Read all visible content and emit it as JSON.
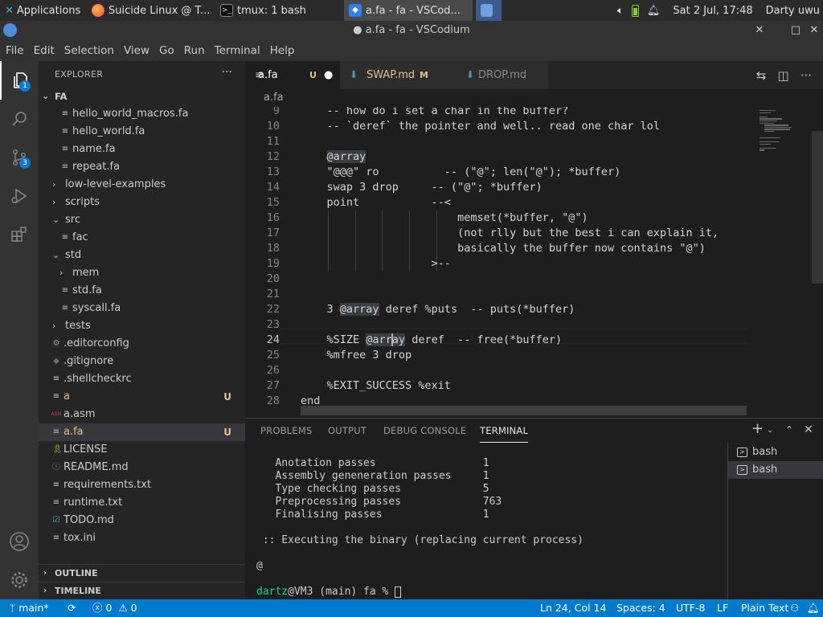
{
  "os_panel": {
    "apps_label": "Applications",
    "tasks": [
      {
        "label": "Suicide Linux @ T...",
        "icon": "firefox-icon"
      },
      {
        "label": "tmux: 1 bash",
        "icon": "terminal-icon"
      },
      {
        "label": "a.fa - fa - VSCod...",
        "icon": "vscodium-icon"
      }
    ],
    "clock": "Sat  2 Jul, 17:48",
    "user": "Darty uwu"
  },
  "window": {
    "title": "● a.fa - fa - VSCodium"
  },
  "menu": [
    "File",
    "Edit",
    "Selection",
    "View",
    "Go",
    "Run",
    "Terminal",
    "Help"
  ],
  "activity": {
    "explorer_badge": "1",
    "scm_badge": "3"
  },
  "sidebar": {
    "header": "EXPLORER",
    "more": "···",
    "root": "FA",
    "items": [
      {
        "label": "hello_world_macros.fa",
        "type": "file",
        "status": ""
      },
      {
        "label": "hello_world.fa",
        "type": "file",
        "status": ""
      },
      {
        "label": "name.fa",
        "type": "file",
        "status": ""
      },
      {
        "label": "repeat.fa",
        "type": "file",
        "status": ""
      },
      {
        "label": "low-level-examples",
        "type": "folder-closed",
        "status": ""
      },
      {
        "label": "scripts",
        "type": "folder-closed",
        "status": ""
      },
      {
        "label": "src",
        "type": "folder-open",
        "status": ""
      },
      {
        "label": "fac",
        "type": "file",
        "status": ""
      },
      {
        "label": "std",
        "type": "folder-open",
        "status": ""
      },
      {
        "label": "mem",
        "type": "folder-closed",
        "status": ""
      },
      {
        "label": "std.fa",
        "type": "file",
        "status": ""
      },
      {
        "label": "syscall.fa",
        "type": "file",
        "status": ""
      },
      {
        "label": "tests",
        "type": "folder-closed",
        "status": ""
      },
      {
        "label": ".editorconfig",
        "type": "gear",
        "status": ""
      },
      {
        "label": ".gitignore",
        "type": "git",
        "status": ""
      },
      {
        "label": ".shellcheckrc",
        "type": "file",
        "status": ""
      },
      {
        "label": "a",
        "type": "file",
        "status": "U"
      },
      {
        "label": "a.asm",
        "type": "asm",
        "status": ""
      },
      {
        "label": "a.fa",
        "type": "file",
        "status": "U"
      },
      {
        "label": "LICENSE",
        "type": "license",
        "status": ""
      },
      {
        "label": "README.md",
        "type": "info",
        "status": ""
      },
      {
        "label": "requirements.txt",
        "type": "file",
        "status": ""
      },
      {
        "label": "runtime.txt",
        "type": "file",
        "status": ""
      },
      {
        "label": "TODO.md",
        "type": "check",
        "status": ""
      },
      {
        "label": "tox.ini",
        "type": "file",
        "status": ""
      }
    ],
    "outline": "OUTLINE",
    "timeline": "TIMELINE"
  },
  "tabs": [
    {
      "label": "a.fa",
      "status": "U",
      "dirty": "●"
    },
    {
      "label": "SWAP.md",
      "status": "M",
      "dirty": ""
    },
    {
      "label": "DROP.md",
      "status": "",
      "dirty": ""
    }
  ],
  "breadcrumb": "a.fa",
  "editor": {
    "lines": [
      {
        "n": "9",
        "text": "    -- how do i set a char in the buffer?"
      },
      {
        "n": "10",
        "text": "    -- `deref` the pointer and well.. read one char lol"
      },
      {
        "n": "11",
        "text": ""
      },
      {
        "n": "12",
        "text": "    @array"
      },
      {
        "n": "13",
        "text": "    \"@@@\" ro          -- (\"@\"; len(\"@\"); *buffer)"
      },
      {
        "n": "14",
        "text": "    swap 3 drop     -- (\"@\"; *buffer)"
      },
      {
        "n": "15",
        "text": "    point           --<"
      },
      {
        "n": "16",
        "text": "                        memset(*buffer, \"@\")"
      },
      {
        "n": "17",
        "text": "                        (not rlly but the best i can explain it,"
      },
      {
        "n": "18",
        "text": "                        basically the buffer now contains \"@\")"
      },
      {
        "n": "19",
        "text": "                    >--"
      },
      {
        "n": "20",
        "text": ""
      },
      {
        "n": "21",
        "text": ""
      },
      {
        "n": "22",
        "text": "    3 @array deref %puts  -- puts(*buffer)"
      },
      {
        "n": "23",
        "text": ""
      },
      {
        "n": "24",
        "text": "    %SIZE @array deref  -- free(*buffer)"
      },
      {
        "n": "25",
        "text": "    %mfree 3 drop"
      },
      {
        "n": "26",
        "text": ""
      },
      {
        "n": "27",
        "text": "    %EXIT_SUCCESS %exit"
      },
      {
        "n": "28",
        "text": "end"
      }
    ]
  },
  "panel": {
    "tabs": [
      "PROBLEMS",
      "OUTPUT",
      "DEBUG CONSOLE",
      "TERMINAL"
    ],
    "terminal_lines": [
      "   Anotation passes                 1",
      "   Assembly geneneration passes     1",
      "   Type checking passes             5",
      "   Preprocessing passes             763",
      "   Finalising passes                1",
      "",
      " :: Executing the binary (replacing current process)",
      "",
      "@",
      "",
      ""
    ],
    "prompt_user": "dartz",
    "prompt_rest": "@VM3 (main) fa % ",
    "terminals": [
      "bash",
      "bash"
    ]
  },
  "statusbar": {
    "branch": "main*",
    "errors": "0",
    "warnings": "0",
    "position": "Ln 24, Col 14",
    "spaces": "Spaces: 4",
    "encoding": "UTF-8",
    "eol": "LF",
    "language": "Plain Text"
  },
  "colors": {
    "accent": "#007acc",
    "git_untracked": "#e2c08d",
    "badge": "#0e7ad1"
  }
}
